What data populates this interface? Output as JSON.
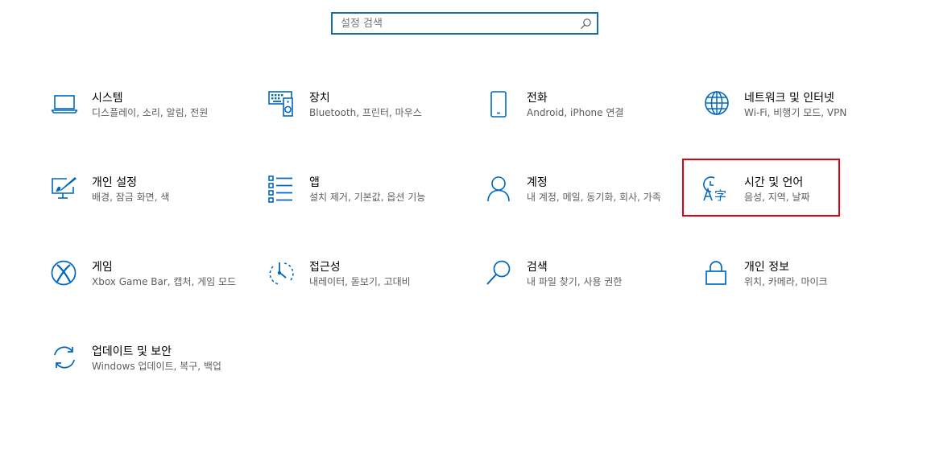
{
  "search": {
    "placeholder": "설정 검색",
    "value": ""
  },
  "accent_color": "#0067c0",
  "highlight_color": "#e2000f",
  "tiles": [
    {
      "icon": "laptop-icon",
      "title": "시스템",
      "desc": "디스플레이, 소리, 알림, 전원"
    },
    {
      "icon": "devices-icon",
      "title": "장치",
      "desc": "Bluetooth, 프린터, 마우스"
    },
    {
      "icon": "phone-icon",
      "title": "전화",
      "desc": "Android, iPhone 연결"
    },
    {
      "icon": "globe-icon",
      "title": "네트워크 및 인터넷",
      "desc": "Wi-Fi, 비행기 모드, VPN"
    },
    {
      "icon": "personalization-icon",
      "title": "개인 설정",
      "desc": "배경, 잠금 화면, 색"
    },
    {
      "icon": "apps-list-icon",
      "title": "앱",
      "desc": "설치 제거, 기본값, 옵션 기능"
    },
    {
      "icon": "person-icon",
      "title": "계정",
      "desc": "내 계정, 메일, 동기화, 회사, 가족"
    },
    {
      "icon": "time-language-icon",
      "title": "시간 및 언어",
      "desc": "음성, 지역, 날짜"
    },
    {
      "icon": "xbox-icon",
      "title": "게임",
      "desc": "Xbox Game Bar, 캡처, 게임 모드"
    },
    {
      "icon": "ease-of-access-icon",
      "title": "접근성",
      "desc": "내레이터, 돋보기, 고대비"
    },
    {
      "icon": "search-magnifier-icon",
      "title": "검색",
      "desc": "내 파일 찾기, 사용 권한"
    },
    {
      "icon": "lock-icon",
      "title": "개인 정보",
      "desc": "위치, 카메라, 마이크"
    },
    {
      "icon": "update-sync-icon",
      "title": "업데이트 및 보안",
      "desc": "Windows 업데이트, 복구, 백업"
    }
  ]
}
